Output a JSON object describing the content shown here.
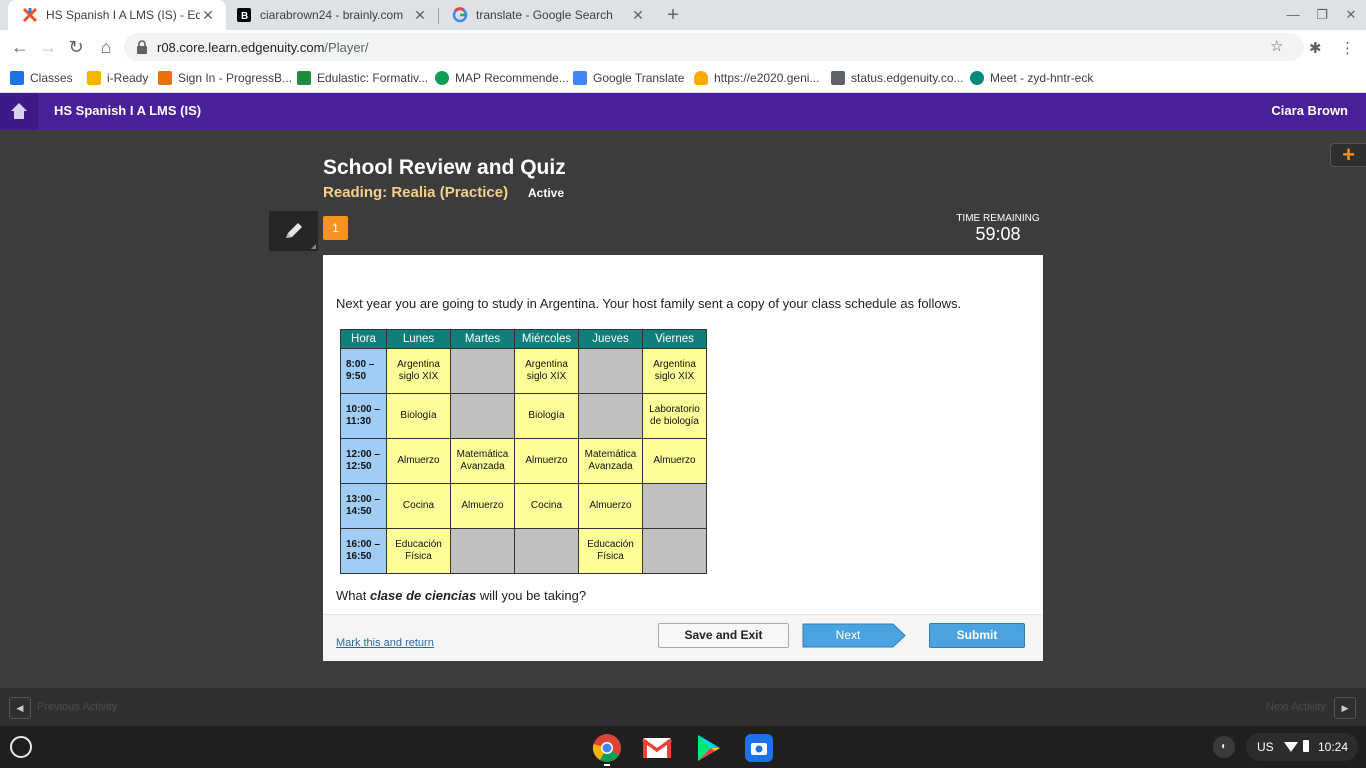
{
  "browser": {
    "tabs": [
      {
        "title": "HS Spanish I A LMS (IS) - Edgenuity",
        "active": true,
        "icon": "edgenuity-icon"
      },
      {
        "title": "ciarabrown24 - brainly.com",
        "active": false,
        "icon": "brainly-icon"
      },
      {
        "title": "translate - Google Search",
        "active": false,
        "icon": "google-icon"
      }
    ],
    "url_host": "r08.core.learn.edgenuity.com",
    "url_path": "/Player/",
    "bookmarks": [
      {
        "label": "Classes",
        "color": "#1a73e8"
      },
      {
        "label": "i-Ready",
        "color": "#f4b400"
      },
      {
        "label": "Sign In - ProgressB...",
        "color": "#e8710a"
      },
      {
        "label": "Edulastic: Formativ...",
        "color": "#1e8e3e"
      },
      {
        "label": "MAP Recommende...",
        "color": "#0f9d58"
      },
      {
        "label": "Google Translate",
        "color": "#4285f4"
      },
      {
        "label": "https://e2020.geni...",
        "color": "#f9ab00"
      },
      {
        "label": "status.edgenuity.co...",
        "color": "#5f6368"
      },
      {
        "label": "Meet - zyd-hntr-eck",
        "color": "#00897b"
      }
    ]
  },
  "app": {
    "course": "HS Spanish I A LMS (IS)",
    "user": "Ciara Brown",
    "lesson_title": "School Review and Quiz",
    "activity": "Reading: Realia (Practice)",
    "status": "Active",
    "question_number": "1",
    "timer_label": "TIME REMAINING",
    "timer": "59:08"
  },
  "content": {
    "prompt": "Next year you are going to study in Argentina.  Your host family sent a copy of your class schedule as follows.",
    "question_pre": "What ",
    "question_em": "clase de ciencias",
    "question_post": " will you be taking?"
  },
  "schedule": {
    "headers": [
      "Hora",
      "Lunes",
      "Martes",
      "Miércoles",
      "Jueves",
      "Viernes"
    ],
    "rows": [
      {
        "time": [
          "8:00 –",
          "9:50"
        ],
        "cells": [
          [
            "Argentina",
            "siglo XIX"
          ],
          [],
          [
            "Argentina",
            "siglo XIX"
          ],
          [],
          [
            "Argentina",
            "siglo XIX"
          ]
        ]
      },
      {
        "time": [
          "10:00 –",
          "11:30"
        ],
        "cells": [
          [
            "Biología"
          ],
          [],
          [
            "Biología"
          ],
          [],
          [
            "Laboratorio",
            "de biología"
          ]
        ]
      },
      {
        "time": [
          "12:00 –",
          "12:50"
        ],
        "cells": [
          [
            "Almuerzo"
          ],
          [
            "Matemática",
            "Avanzada"
          ],
          [
            "Almuerzo"
          ],
          [
            "Matemática",
            "Avanzada"
          ],
          [
            "Almuerzo"
          ]
        ]
      },
      {
        "time": [
          "13:00 –",
          "14:50"
        ],
        "cells": [
          [
            "Cocina"
          ],
          [
            "Almuerzo"
          ],
          [
            "Cocina"
          ],
          [
            "Almuerzo"
          ],
          []
        ]
      },
      {
        "time": [
          "16:00 –",
          "16:50"
        ],
        "cells": [
          [
            "Educación",
            "Física"
          ],
          [],
          [],
          [
            "Educación",
            "Física"
          ],
          []
        ]
      }
    ]
  },
  "footer": {
    "mark_label": "Mark this and return",
    "save_label": "Save and Exit",
    "next_label": "Next",
    "submit_label": "Submit"
  },
  "activity_nav": {
    "prev_label": "Previous Activity",
    "next_label": "Next Activity"
  },
  "shelf": {
    "apps": [
      "chrome-icon",
      "gmail-icon",
      "play-store-icon",
      "files-icon"
    ],
    "keyboard": "US",
    "time": "10:24"
  }
}
